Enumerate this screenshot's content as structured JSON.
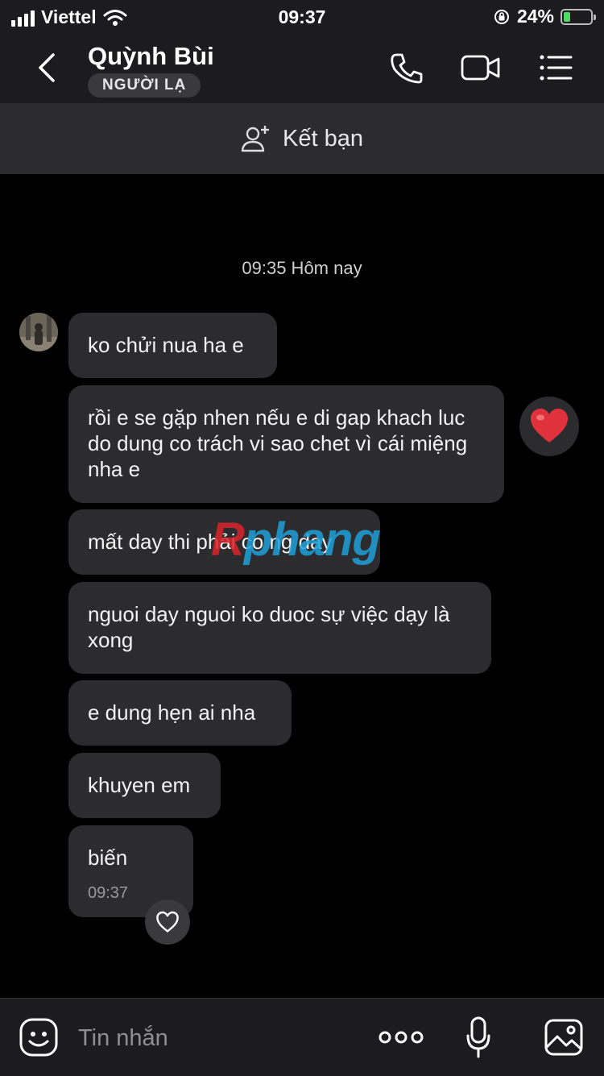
{
  "status_bar": {
    "carrier": "Viettel",
    "time": "09:37",
    "battery": "24%",
    "battery_level": 0.24
  },
  "header": {
    "contact_name": "Quỳnh Bùi",
    "badge": "NGƯỜI LẠ"
  },
  "friend_bar": {
    "label": "Kết bạn"
  },
  "chat": {
    "date_divider": "09:35 Hôm nay",
    "messages": [
      {
        "text": "ko chửi nua ha e"
      },
      {
        "text": "rồi e se gặp nhen nếu e di gap khach luc do dung co trách vi sao chet vì cái miệng nha e"
      },
      {
        "text": "mất day thi phải co ng day"
      },
      {
        "text": "nguoi day nguoi ko duoc sự việc dạy là xong"
      },
      {
        "text": "e dung hẹn ai nha"
      },
      {
        "text": "khuyen em"
      },
      {
        "text": "biến",
        "time": "09:37"
      }
    ],
    "watermark": {
      "part1": "R",
      "part2": "phang"
    }
  },
  "bottom_bar": {
    "placeholder": "Tin nhắn"
  },
  "colors": {
    "background": "#000000",
    "bubble": "#2c2c2e",
    "bar": "#1c1c1e",
    "reaction_heart": "#e0323c",
    "battery_fill": "#4cd964"
  }
}
